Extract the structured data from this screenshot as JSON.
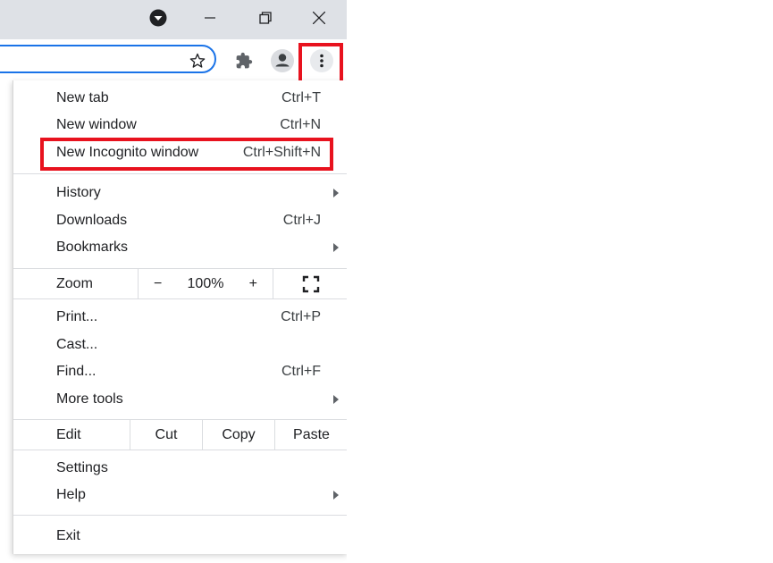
{
  "toolbar": {
    "bookmark_icon": "star-outline-icon",
    "extensions_icon": "puzzle-icon",
    "profile_icon": "person-icon",
    "menu_icon": "vertical-dots-icon"
  },
  "window_controls": [
    "profile-dropdown-icon",
    "minimize-icon",
    "restore-icon",
    "close-icon"
  ],
  "highlight_color": "#e8121e",
  "menu": {
    "new_tab": {
      "label": "New tab",
      "shortcut": "Ctrl+T"
    },
    "new_window": {
      "label": "New window",
      "shortcut": "Ctrl+N"
    },
    "new_incognito": {
      "label": "New Incognito window",
      "shortcut": "Ctrl+Shift+N"
    },
    "history": {
      "label": "History"
    },
    "downloads": {
      "label": "Downloads",
      "shortcut": "Ctrl+J"
    },
    "bookmarks": {
      "label": "Bookmarks"
    },
    "zoom": {
      "label": "Zoom",
      "minus": "−",
      "level": "100%",
      "plus": "+"
    },
    "print": {
      "label": "Print...",
      "shortcut": "Ctrl+P"
    },
    "cast": {
      "label": "Cast..."
    },
    "find": {
      "label": "Find...",
      "shortcut": "Ctrl+F"
    },
    "more_tools": {
      "label": "More tools"
    },
    "edit": {
      "label": "Edit",
      "cut": "Cut",
      "copy": "Copy",
      "paste": "Paste"
    },
    "settings": {
      "label": "Settings"
    },
    "help": {
      "label": "Help"
    },
    "exit": {
      "label": "Exit"
    }
  }
}
